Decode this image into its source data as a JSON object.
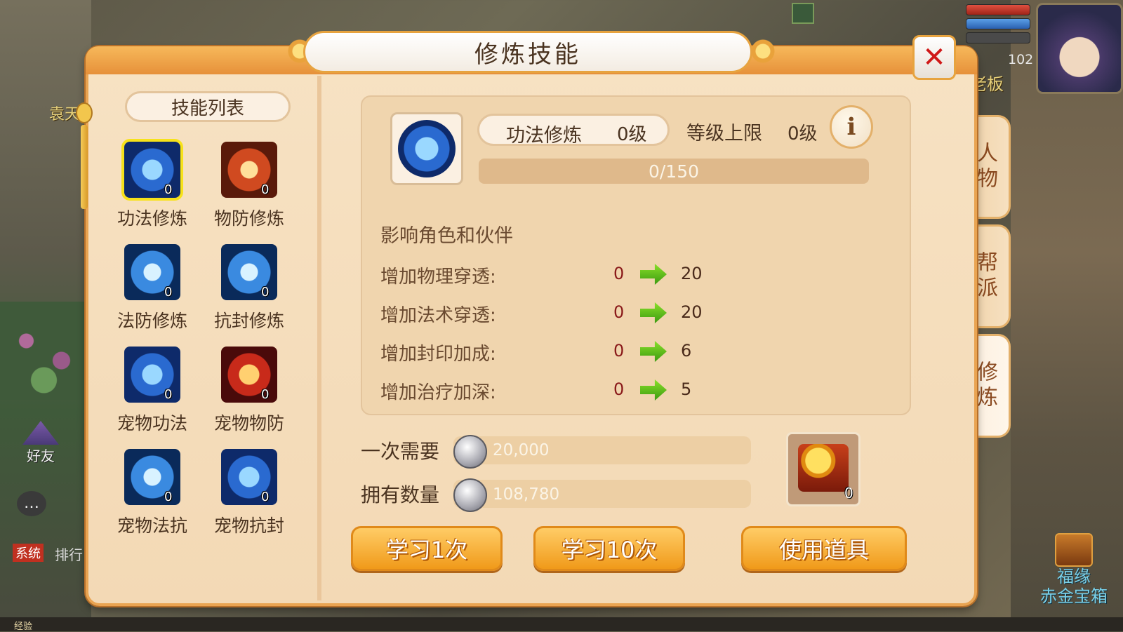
{
  "hud": {
    "npc_name": "袁天",
    "player_level": "102",
    "player_name": "老板",
    "friend_label": "好友",
    "chat_icon": "chat-bubble-icon",
    "system_tag": "系统",
    "system_text": "排行",
    "chest_line1": "福缘",
    "chest_line2": "赤金宝箱",
    "exp_label": "经验"
  },
  "window": {
    "title": "修炼技能",
    "close_label": "✕"
  },
  "skill_list": {
    "header": "技能列表",
    "items": [
      {
        "label": "功法修炼",
        "count": "0",
        "selected": true
      },
      {
        "label": "物防修炼",
        "count": "0"
      },
      {
        "label": "法防修炼",
        "count": "0"
      },
      {
        "label": "抗封修炼",
        "count": "0"
      },
      {
        "label": "宠物功法",
        "count": "0"
      },
      {
        "label": "宠物物防",
        "count": "0"
      },
      {
        "label": "宠物法抗",
        "count": "0"
      },
      {
        "label": "宠物抗封",
        "count": "0"
      }
    ]
  },
  "detail": {
    "skill_name": "功法修炼",
    "skill_level": "0级",
    "cap_label": "等级上限",
    "cap_value": "0级",
    "info_icon": "i",
    "progress_text": "0/150",
    "progress_current": 0,
    "progress_max": 150,
    "affects": "影响角色和伙伴",
    "stats": [
      {
        "name": "增加物理穿透:",
        "from": "0",
        "to": "20"
      },
      {
        "name": "增加法术穿透:",
        "from": "0",
        "to": "20"
      },
      {
        "name": "增加封印加成:",
        "from": "0",
        "to": "6"
      },
      {
        "name": "增加治疗加深:",
        "from": "0",
        "to": "5"
      }
    ]
  },
  "cost": {
    "need_label": "一次需要",
    "need_value": "20,000",
    "own_label": "拥有数量",
    "own_value": "108,780"
  },
  "item": {
    "count": "0"
  },
  "buttons": {
    "learn1": "学习1次",
    "learn10": "学习10次",
    "use_item": "使用道具"
  },
  "side_tabs": [
    {
      "label": "人物"
    },
    {
      "label": "帮派"
    },
    {
      "label": "修炼",
      "active": true
    }
  ]
}
